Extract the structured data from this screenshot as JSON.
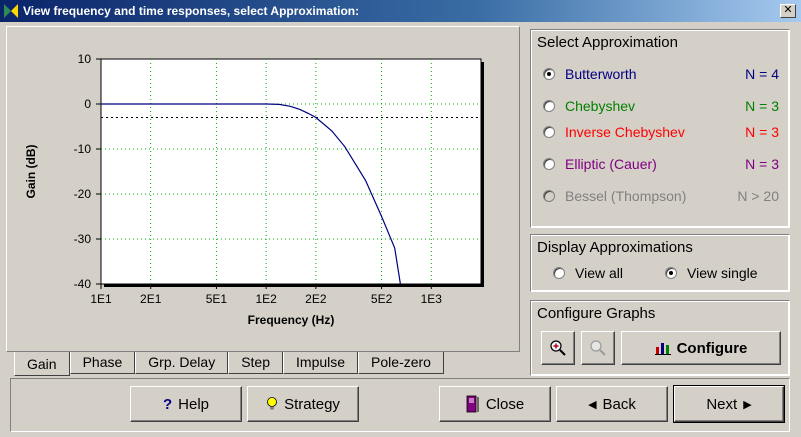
{
  "window": {
    "title": "View frequency and time responses, select Approximation:",
    "close_glyph": "✕"
  },
  "chart_data": {
    "type": "line",
    "xlabel": "Frequency  (Hz)",
    "ylabel": "Gain  (dB)",
    "x_scale": "log",
    "xlim": [
      10,
      2000
    ],
    "ylim": [
      -40,
      10
    ],
    "x_ticks": [
      10,
      20,
      50,
      100,
      200,
      500,
      1000
    ],
    "x_tick_labels": [
      "1E1",
      "2E1",
      "5E1",
      "1E2",
      "2E2",
      "5E2",
      "1E3"
    ],
    "y_ticks": [
      10,
      0,
      -10,
      -20,
      -30,
      -40
    ],
    "y_tick_labels": [
      "10",
      "0",
      "-10",
      "-20",
      "-30",
      "-40"
    ],
    "grid": true,
    "reference_level_db": -3,
    "series": [
      {
        "color": "#000080",
        "x": [
          10,
          20,
          50,
          80,
          100,
          120,
          140,
          160,
          180,
          200,
          250,
          300,
          400,
          500,
          600,
          650
        ],
        "y": [
          0,
          0,
          0,
          0,
          0,
          -0.1,
          -0.5,
          -1.2,
          -2.1,
          -3.0,
          -6.0,
          -9.5,
          -17.0,
          -25.0,
          -32.0,
          -40.0
        ]
      }
    ]
  },
  "tabs": [
    {
      "label": "Gain",
      "active": true
    },
    {
      "label": "Phase",
      "active": false
    },
    {
      "label": "Grp. Delay",
      "active": false
    },
    {
      "label": "Step",
      "active": false
    },
    {
      "label": "Impulse",
      "active": false
    },
    {
      "label": "Pole-zero",
      "active": false
    }
  ],
  "approximation": {
    "title": "Select Approximation",
    "options": [
      {
        "label": "Butterworth",
        "order": "N = 4",
        "color": "#000080",
        "selected": true,
        "disabled": false
      },
      {
        "label": "Chebyshev",
        "order": "N = 3",
        "color": "#008000",
        "selected": false,
        "disabled": false
      },
      {
        "label": "Inverse Chebyshev",
        "order": "N = 3",
        "color": "#ff0000",
        "selected": false,
        "disabled": false
      },
      {
        "label": "Elliptic  (Cauer)",
        "order": "N = 3",
        "color": "#800080",
        "selected": false,
        "disabled": false
      },
      {
        "label": "Bessel (Thompson)",
        "order": "N > 20",
        "color": "#808080",
        "selected": false,
        "disabled": true
      }
    ]
  },
  "display": {
    "title": "Display Approximations",
    "view_all": "View all",
    "view_single": "View single",
    "selected": "view_single"
  },
  "configure": {
    "title": "Configure Graphs",
    "zoom_in_icon": "zoom-in-icon",
    "zoom_out_icon": "zoom-out-icon",
    "configure_label": "Configure"
  },
  "buttons": {
    "help": "Help",
    "strategy": "Strategy",
    "close": "Close",
    "back": "Back",
    "next": "Next"
  }
}
